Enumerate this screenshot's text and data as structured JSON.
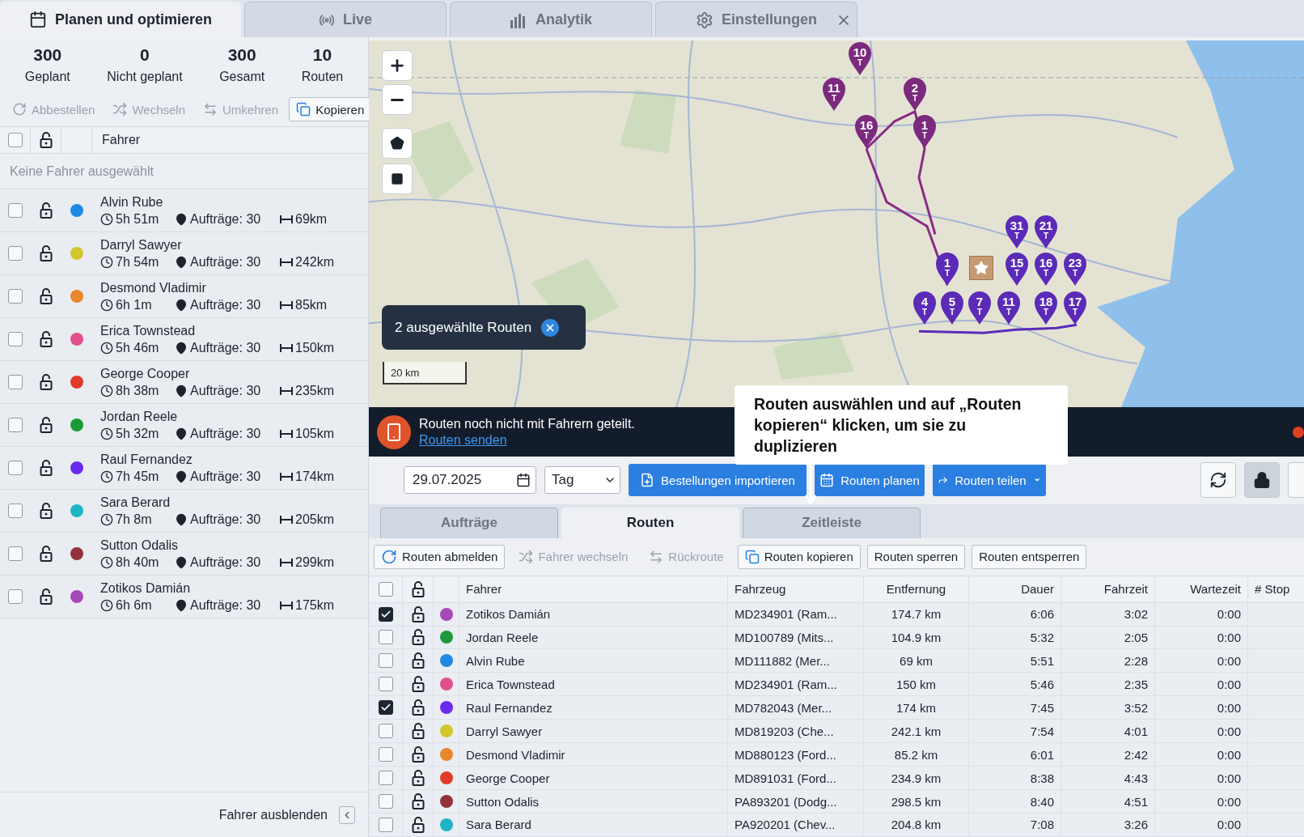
{
  "app_tabs": [
    {
      "label": "Planen und optimieren",
      "selected": true
    },
    {
      "label": "Live",
      "selected": false
    },
    {
      "label": "Analytik",
      "selected": false
    },
    {
      "label": "Einstellungen",
      "selected": false
    }
  ],
  "summary": [
    {
      "value": "300",
      "label": "Geplant"
    },
    {
      "value": "0",
      "label": "Nicht geplant"
    },
    {
      "value": "300",
      "label": "Gesamt"
    },
    {
      "value": "10",
      "label": "Routen"
    }
  ],
  "driver_actions": [
    {
      "label": "Abbestellen",
      "disabled": true
    },
    {
      "label": "Wechseln",
      "disabled": true
    },
    {
      "label": "Umkehren",
      "disabled": true
    },
    {
      "label": "Kopieren",
      "disabled": false
    }
  ],
  "driver_list": {
    "header_checked": false,
    "header_locked": false,
    "column": "Fahrer",
    "empty_note": "Keine Fahrer ausgewählt",
    "drivers": [
      {
        "name": "Alvin Rube",
        "time": "5h 51m",
        "orders": "Aufträge: 30",
        "distance": "69km",
        "color": "#1e88e5",
        "checked": false,
        "locked": false
      },
      {
        "name": "Darryl Sawyer",
        "time": "7h 54m",
        "orders": "Aufträge: 30",
        "distance": "242km",
        "color": "#d4c62a",
        "checked": false,
        "locked": false
      },
      {
        "name": "Desmond Vladimir",
        "time": "6h 1m",
        "orders": "Aufträge: 30",
        "distance": "85km",
        "color": "#e8872c",
        "checked": false,
        "locked": false
      },
      {
        "name": "Erica Townstead",
        "time": "5h 46m",
        "orders": "Aufträge: 30",
        "distance": "150km",
        "color": "#e0508a",
        "checked": false,
        "locked": false
      },
      {
        "name": "George Cooper",
        "time": "8h 38m",
        "orders": "Aufträge: 30",
        "distance": "235km",
        "color": "#e23a2a",
        "checked": false,
        "locked": false
      },
      {
        "name": "Jordan Reele",
        "time": "5h 32m",
        "orders": "Aufträge: 30",
        "distance": "105km",
        "color": "#1a9a3a",
        "checked": false,
        "locked": false
      },
      {
        "name": "Raul Fernandez",
        "time": "7h 45m",
        "orders": "Aufträge: 30",
        "distance": "174km",
        "color": "#6a2bee",
        "checked": false,
        "locked": false
      },
      {
        "name": "Sara Berard",
        "time": "7h 8m",
        "orders": "Aufträge: 30",
        "distance": "205km",
        "color": "#1fb5c4",
        "checked": false,
        "locked": false
      },
      {
        "name": "Sutton Odalis",
        "time": "8h 40m",
        "orders": "Aufträge: 30",
        "distance": "299km",
        "color": "#94323c",
        "checked": false,
        "locked": false
      },
      {
        "name": "Zotikos Damián",
        "time": "6h 6m",
        "orders": "Aufträge: 30",
        "distance": "175km",
        "color": "#a649b8",
        "checked": false,
        "locked": false
      }
    ],
    "hide_label": "Fahrer ausblenden"
  },
  "map": {
    "selection_chip": "2 ausgewählte Routen",
    "scale": "20 km",
    "pins": [
      {
        "label": "10",
        "sub": "T",
        "color": "#7b2a7e"
      },
      {
        "label": "11",
        "sub": "T",
        "color": "#7b2a7e"
      },
      {
        "label": "2",
        "sub": "T",
        "color": "#7b2a7e"
      },
      {
        "label": "16",
        "sub": "T",
        "color": "#7b2a7e"
      },
      {
        "label": "1",
        "sub": "T",
        "color": "#7b2a7e"
      },
      {
        "label": "31",
        "sub": "T",
        "color": "#5b2bb8"
      },
      {
        "label": "21",
        "sub": "T",
        "color": "#5b2bb8"
      },
      {
        "label": "1",
        "sub": "T",
        "color": "#5b2bb8"
      },
      {
        "label": "15",
        "sub": "T",
        "color": "#5b2bb8"
      },
      {
        "label": "16",
        "sub": "T",
        "color": "#5b2bb8"
      },
      {
        "label": "23",
        "sub": "T",
        "color": "#5b2bb8"
      },
      {
        "label": "4",
        "sub": "T",
        "color": "#5b2bb8"
      },
      {
        "label": "5",
        "sub": "T",
        "color": "#5b2bb8"
      },
      {
        "label": "7",
        "sub": "T",
        "color": "#5b2bb8"
      },
      {
        "label": "11",
        "sub": "T",
        "color": "#5b2bb8"
      },
      {
        "label": "18",
        "sub": "T",
        "color": "#5b2bb8"
      },
      {
        "label": "17",
        "sub": "T",
        "color": "#5b2bb8"
      }
    ]
  },
  "banner": {
    "message": "Routen noch nicht mit Fahrern geteilt.",
    "link": "Routen senden"
  },
  "callout": "Routen auswählen und auf „Routen kopieren“ klicken, um sie zu duplizieren",
  "toolbar": {
    "date": "29.07.2025",
    "period": "Tag",
    "buttons": [
      "Bestellungen importieren",
      "Routen planen",
      "Routen teilen"
    ]
  },
  "view_tabs": [
    {
      "label": "Aufträge",
      "selected": false
    },
    {
      "label": "Routen",
      "selected": true
    },
    {
      "label": "Zeitleiste",
      "selected": false
    }
  ],
  "route_actions": [
    {
      "label": "Routen abmelden",
      "disabled": false
    },
    {
      "label": "Fahrer wechseln",
      "disabled": true
    },
    {
      "label": "Rückroute",
      "disabled": true
    },
    {
      "label": "Routen kopieren",
      "disabled": false
    },
    {
      "label": "Routen sperren",
      "disabled": false
    },
    {
      "label": "Routen entsperren",
      "disabled": false
    }
  ],
  "table": {
    "header_checked": false,
    "header_locked": false,
    "columns": [
      "Fahrer",
      "Fahrzeug",
      "Entfernung",
      "Dauer",
      "Fahrzeit",
      "Wartezeit",
      "# Stop"
    ],
    "rows": [
      {
        "checked": true,
        "locked": false,
        "color": "#a649b8",
        "cells": [
          "Zotikos Damián",
          "MD234901 (Ram...",
          "174.7 km",
          "6:06",
          "3:02",
          "0:00"
        ]
      },
      {
        "checked": false,
        "locked": false,
        "color": "#1a9a3a",
        "cells": [
          "Jordan Reele",
          "MD100789 (Mits...",
          "104.9 km",
          "5:32",
          "2:05",
          "0:00"
        ]
      },
      {
        "checked": false,
        "locked": false,
        "color": "#1e88e5",
        "cells": [
          "Alvin Rube",
          "MD111882 (Mer...",
          "69 km",
          "5:51",
          "2:28",
          "0:00"
        ]
      },
      {
        "checked": false,
        "locked": false,
        "color": "#e0508a",
        "cells": [
          "Erica Townstead",
          "MD234901 (Ram...",
          "150 km",
          "5:46",
          "2:35",
          "0:00"
        ]
      },
      {
        "checked": true,
        "locked": false,
        "color": "#6a2bee",
        "cells": [
          "Raul Fernandez",
          "MD782043 (Mer...",
          "174 km",
          "7:45",
          "3:52",
          "0:00"
        ]
      },
      {
        "checked": false,
        "locked": false,
        "color": "#d4c62a",
        "cells": [
          "Darryl Sawyer",
          "MD819203 (Che...",
          "242.1 km",
          "7:54",
          "4:01",
          "0:00"
        ]
      },
      {
        "checked": false,
        "locked": false,
        "color": "#e8872c",
        "cells": [
          "Desmond Vladimir",
          "MD880123 (Ford...",
          "85.2 km",
          "6:01",
          "2:42",
          "0:00"
        ]
      },
      {
        "checked": false,
        "locked": false,
        "color": "#e23a2a",
        "cells": [
          "George Cooper",
          "MD891031 (Ford...",
          "234.9 km",
          "8:38",
          "4:43",
          "0:00"
        ]
      },
      {
        "checked": false,
        "locked": false,
        "color": "#94323c",
        "cells": [
          "Sutton Odalis",
          "PA893201 (Dodg...",
          "298.5 km",
          "8:40",
          "4:51",
          "0:00"
        ]
      },
      {
        "checked": false,
        "locked": false,
        "color": "#1fb5c4",
        "cells": [
          "Sara Berard",
          "PA920201 (Chev...",
          "204.8 km",
          "7:08",
          "3:26",
          "0:00"
        ]
      }
    ]
  }
}
